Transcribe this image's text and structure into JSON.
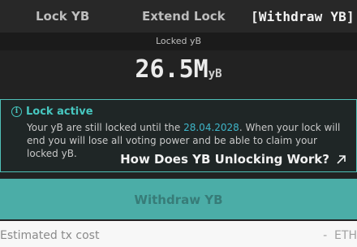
{
  "tabs": [
    {
      "label": "Lock YB"
    },
    {
      "label": "Extend Lock"
    },
    {
      "label": "[Withdraw YB]"
    }
  ],
  "locked": {
    "label": "Locked yB",
    "amount": "26.5M",
    "unit": "yB"
  },
  "alert": {
    "title": "Lock active",
    "text_before": "Your yB are still locked until the ",
    "date": "28.04.2028",
    "text_after": ". When your lock will end you will lose all voting power and be able to claim your locked yB.",
    "link_label": "How Does YB Unlocking Work?",
    "title_icon": "info-icon",
    "link_icon": "arrow-up-right-icon",
    "accent_color": "#47c7c0"
  },
  "withdraw_button": {
    "label": "Withdraw YB",
    "color": "#4bada7"
  },
  "tx": {
    "label": "Estimated tx cost",
    "value": "-  ETH"
  }
}
